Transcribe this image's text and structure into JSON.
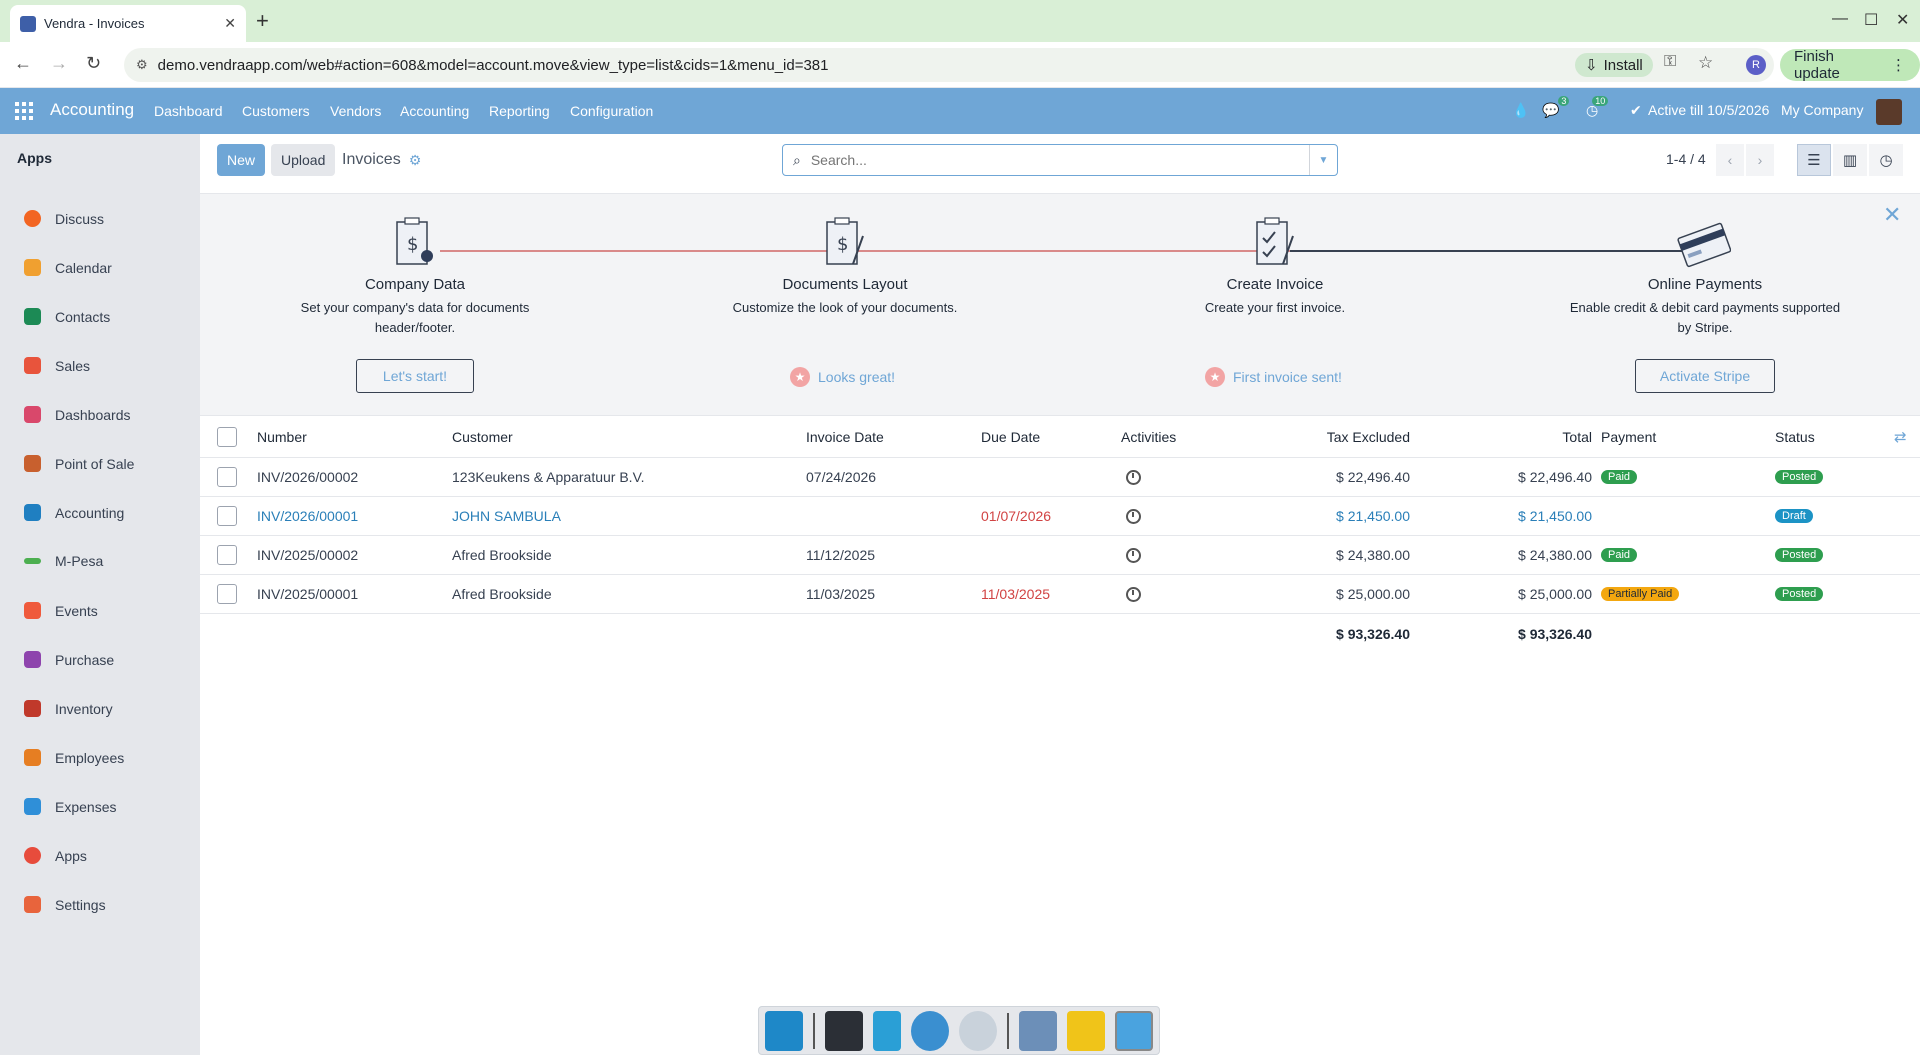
{
  "browser": {
    "tab_title": "Vendra - Invoices",
    "url": "demo.vendraapp.com/web#action=608&model=account.move&view_type=list&cids=1&menu_id=381",
    "install_label": "Install",
    "profile_initial": "R",
    "finish_update_label": "Finish update"
  },
  "appbar": {
    "brand": "Accounting",
    "menu": [
      "Dashboard",
      "Customers",
      "Vendors",
      "Accounting",
      "Reporting",
      "Configuration"
    ],
    "chat_badge": "3",
    "activity_badge": "10",
    "active_till": "Active till 10/5/2026",
    "company": "My Company"
  },
  "sidebar": {
    "heading": "Apps",
    "items": [
      {
        "label": "Discuss",
        "color": "#f26522"
      },
      {
        "label": "Calendar",
        "color": "#f0a030"
      },
      {
        "label": "Contacts",
        "color": "#1c8a55"
      },
      {
        "label": "Sales",
        "color": "#e8543c"
      },
      {
        "label": "Dashboards",
        "color": "#d9486b"
      },
      {
        "label": "Point of Sale",
        "color": "#c8602e"
      },
      {
        "label": "Accounting",
        "color": "#1f7fc1"
      },
      {
        "label": "M-Pesa",
        "color": "#4caf50"
      },
      {
        "label": "Events",
        "color": "#ef5a3c"
      },
      {
        "label": "Purchase",
        "color": "#8e44ad"
      },
      {
        "label": "Inventory",
        "color": "#c0392b"
      },
      {
        "label": "Employees",
        "color": "#e67e22"
      },
      {
        "label": "Expenses",
        "color": "#2f8fd8"
      },
      {
        "label": "Apps",
        "color": "#e74c3c"
      },
      {
        "label": "Settings",
        "color": "#e8643c"
      }
    ]
  },
  "control": {
    "new_label": "New",
    "upload_label": "Upload",
    "breadcrumb": "Invoices",
    "search_placeholder": "Search...",
    "pager": "1-4 / 4"
  },
  "onboarding": {
    "steps": [
      {
        "title": "Company Data",
        "desc": "Set your company's data for documents header/footer.",
        "action": "Let's start!",
        "done": false
      },
      {
        "title": "Documents Layout",
        "desc": "Customize the look of your documents.",
        "action": "Looks great!",
        "done": true
      },
      {
        "title": "Create Invoice",
        "desc": "Create your first invoice.",
        "action": "First invoice sent!",
        "done": true
      },
      {
        "title": "Online Payments",
        "desc": "Enable credit & debit card payments supported by Stripe.",
        "action": "Activate Stripe",
        "done": false
      }
    ]
  },
  "table": {
    "columns": [
      "Number",
      "Customer",
      "Invoice Date",
      "Due Date",
      "Activities",
      "Tax Excluded",
      "Total",
      "Payment",
      "Status"
    ],
    "rows": [
      {
        "number": "INV/2026/00002",
        "customer": "123Keukens & Apparatuur B.V.",
        "invoice_date": "07/24/2026",
        "due_date": "",
        "tax_excluded": "$ 22,496.40",
        "total": "$ 22,496.40",
        "payment": "Paid",
        "status": "Posted"
      },
      {
        "number": "INV/2026/00001",
        "customer": "JOHN SAMBULA",
        "invoice_date": "",
        "due_date": "01/07/2026",
        "tax_excluded": "$ 21,450.00",
        "total": "$ 21,450.00",
        "payment": "",
        "status": "Draft"
      },
      {
        "number": "INV/2025/00002",
        "customer": "Afred Brookside",
        "invoice_date": "11/12/2025",
        "due_date": "",
        "tax_excluded": "$ 24,380.00",
        "total": "$ 24,380.00",
        "payment": "Paid",
        "status": "Posted"
      },
      {
        "number": "INV/2025/00001",
        "customer": "Afred Brookside",
        "invoice_date": "11/03/2025",
        "due_date": "11/03/2025",
        "tax_excluded": "$ 25,000.00",
        "total": "$ 25,000.00",
        "payment": "Partially Paid",
        "status": "Posted"
      }
    ],
    "totals": {
      "tax_excluded": "$ 93,326.40",
      "total": "$ 93,326.40"
    }
  }
}
